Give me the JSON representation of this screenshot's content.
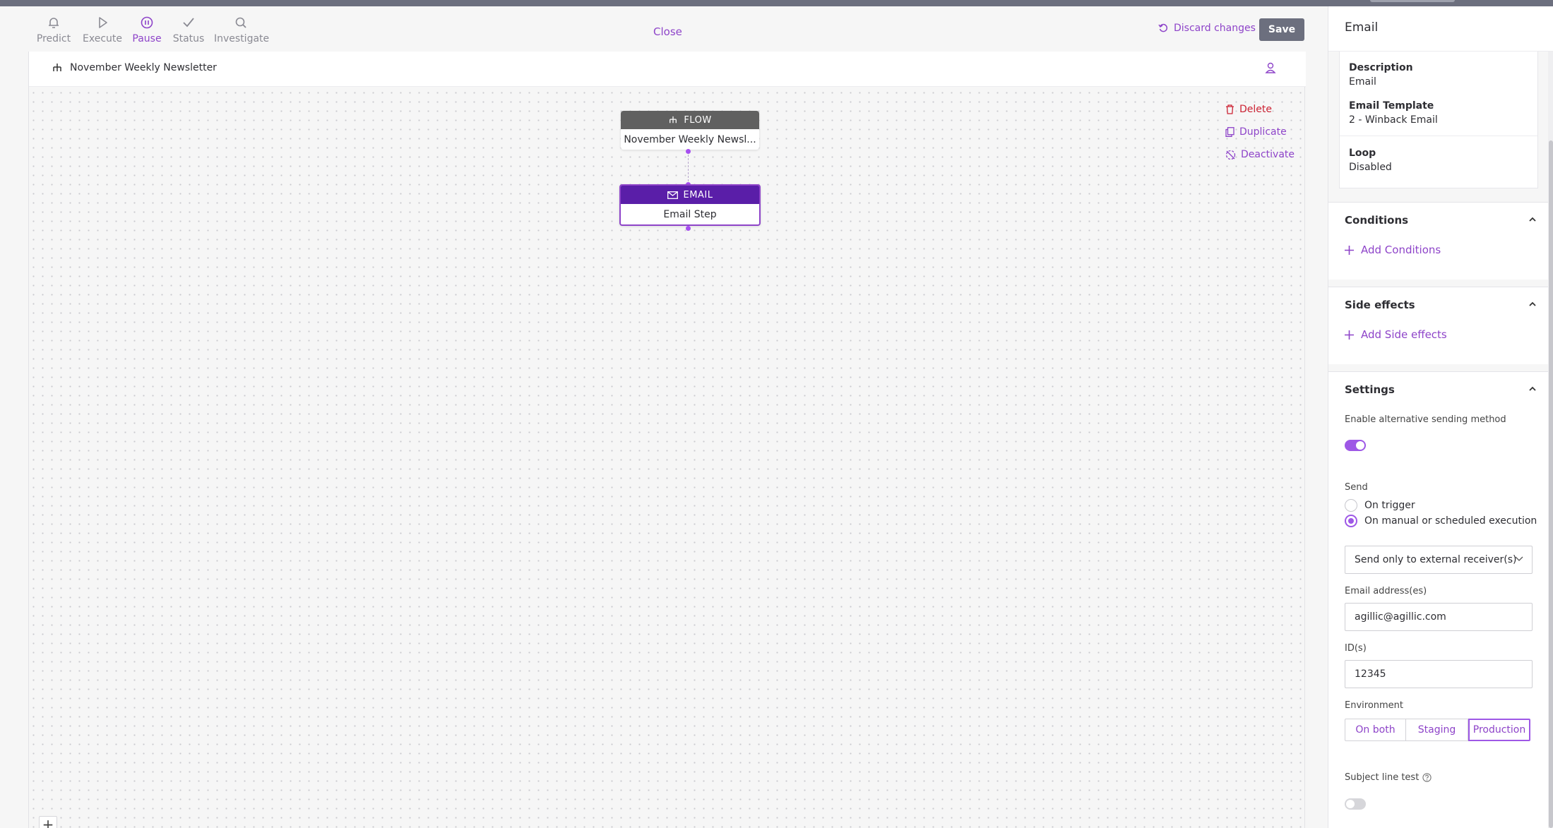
{
  "toolbar": {
    "tools": [
      {
        "label": "Predict",
        "icon": "bell-icon"
      },
      {
        "label": "Execute",
        "icon": "play-icon"
      },
      {
        "label": "Pause",
        "icon": "pause-icon"
      },
      {
        "label": "Status",
        "icon": "check-icon"
      },
      {
        "label": "Investigate",
        "icon": "search-icon"
      }
    ],
    "close_label": "Close",
    "discard_label": "Discard changes",
    "save_label": "Save"
  },
  "canvas": {
    "flow_title": "November Weekly Newsletter",
    "flow_node": {
      "type_label": "FLOW",
      "name": "November Weekly Newsl..."
    },
    "email_node": {
      "type_label": "EMAIL",
      "name": "Email Step"
    },
    "actions": {
      "delete": "Delete",
      "duplicate": "Duplicate",
      "deactivate": "Deactivate"
    },
    "add_label": "+"
  },
  "panel": {
    "title": "Email",
    "details": {
      "description_label": "Description",
      "description_value": "Email",
      "template_label": "Email Template",
      "template_value": "2 - Winback Email",
      "loop_label": "Loop",
      "loop_value": "Disabled"
    },
    "conditions": {
      "title": "Conditions",
      "add_label": "Add Conditions"
    },
    "side_effects": {
      "title": "Side effects",
      "add_label": "Add Side effects"
    },
    "settings": {
      "title": "Settings",
      "alt_method_label": "Enable alternative sending method",
      "alt_method_on": true,
      "send_label": "Send",
      "send_options": [
        "On trigger",
        "On manual or scheduled execution"
      ],
      "send_selected": "On manual or scheduled execution",
      "receiver_select": "Send only to external receiver(s)",
      "email_label": "Email address(es)",
      "email_value": "agillic@agillic.com",
      "ids_label": "ID(s)",
      "ids_value": "12345",
      "environment_label": "Environment",
      "environment_options": [
        "On both",
        "Staging",
        "Production"
      ],
      "environment_selected": "Production",
      "subject_test_label": "Subject line test",
      "subject_test_on": false
    }
  },
  "colors": {
    "accent": "#8e44c9",
    "email_header": "#5a1ea8",
    "flow_header": "#606060",
    "danger": "#cc2233",
    "save_bg": "#6c6f7e"
  }
}
